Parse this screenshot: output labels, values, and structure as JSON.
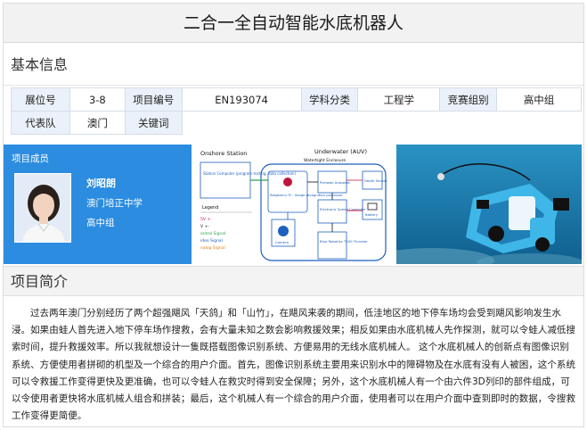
{
  "page": {
    "title": "二合一全自动智能水底机器人"
  },
  "basic_info": {
    "heading": "基本信息",
    "row1": [
      {
        "label": "展位号",
        "value": "3-8"
      },
      {
        "label": "项目编号",
        "value": "EN193074"
      },
      {
        "label": "学科分类",
        "value": "工程学"
      },
      {
        "label": "竞赛组别",
        "value": "高中组"
      }
    ],
    "row2": [
      {
        "label": "代表队",
        "value": "澳门"
      },
      {
        "label": "关键词",
        "value": ""
      }
    ]
  },
  "member": {
    "title": "项目成员",
    "name": "刘昭朗",
    "school": "澳门培正中学",
    "grade": "高中组"
  },
  "diagram": {
    "onshore": "Onshore Station",
    "underwater": "Underwater (AUV)",
    "enclosure": "Watertight Enclosure",
    "ground_pc": "Station Computer (program testing, data collection)",
    "raspberry": "Raspberry Pi - Image recognition processor",
    "pixhawk": "Pixhawk Autopilot",
    "depth": "Depth Sensor",
    "esc": "Electronic Speed Controller",
    "battery": "Battery",
    "camera": "Camera",
    "thruster": "Blue Robotics T200 Thruster",
    "legend_title": "Legend",
    "legend_1": "5V +-",
    "legend_2": "V +-",
    "legend_3": "ontrol Signal",
    "legend_4": "ideo Signal",
    "legend_5": "nalog Signal"
  },
  "intro": {
    "heading": "项目简介",
    "text": "过去两年澳门分别经历了两个超强飓风「天鸽」和「山竹」，在飓风来袭的期间，低洼地区的地下停车场均会受到飓风影响发生水浸。如果由蛙人首先进入地下停车场作搜救，会有大量未知之数会影响救援效果；相反如果由水底机械人先作探测，就可以令蛙人减低搜索时间，提升救援效率。所以我就想设计一隻既搭载图像识别系统、方便易用的无线水底机械人。 这个水底机械人的创新点有图像识别系统、方便使用者拼砌的机型及一个综合的用户介面。首先，图像识别系统主要用来识别水中的障碍物及在水底有没有人被困，这个系统可以令救援工作变得更快及更准确，也可以令蛙人在救灾时得到安全保障；另外，这个水底机械人有一个由六件3D列印的部件组成，可以令使用者更快将水底机械人组合和拼装；最后，这个机械人有一个综合的用户介面，使用者可以在用户介面中查到即时的数据，令搜救工作变得更简便。"
  },
  "colors": {
    "member_card": "#2b8ce0",
    "label_cell": "#eaf1fa",
    "diagram_blue": "#1f5fbf",
    "water": "#1e7fb0",
    "robot": "#3fb6e8"
  }
}
